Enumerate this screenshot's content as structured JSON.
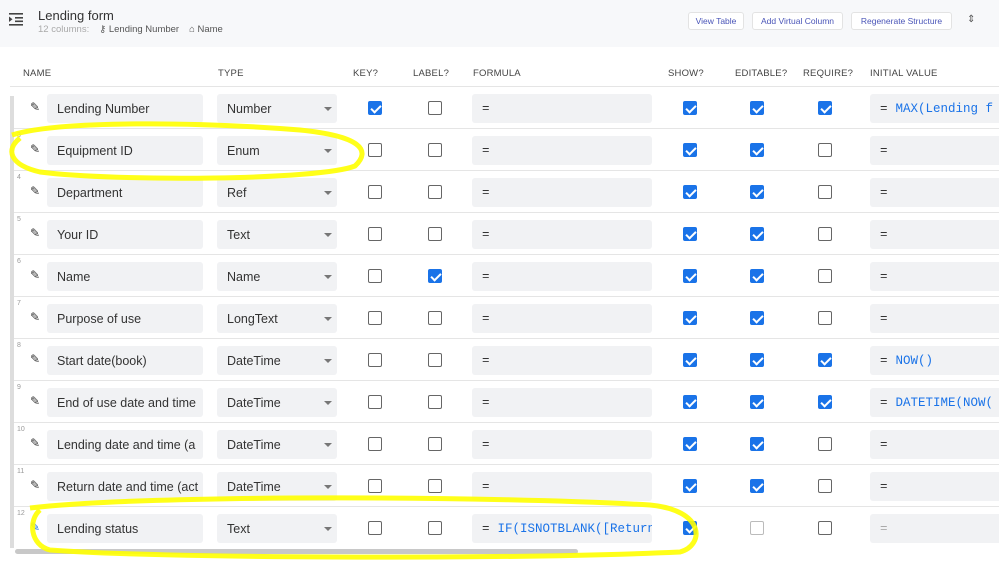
{
  "header": {
    "title": "Lending form",
    "columns_count": "12 columns:",
    "key_column": "Lending Number",
    "label_column": "Name",
    "buttons": {
      "view_table": "View Table",
      "add_virtual_column": "Add Virtual Column",
      "regenerate_structure": "Regenerate Structure"
    }
  },
  "columns": {
    "name": "NAME",
    "type": "TYPE",
    "key": "KEY?",
    "label": "LABEL?",
    "formula": "FORMULA",
    "show": "SHOW?",
    "editable": "EDITABLE?",
    "require": "REQUIRE?",
    "initial_value": "INITIAL VALUE"
  },
  "rows": [
    {
      "num": "",
      "name": "Lending Number",
      "type": "Number",
      "key": true,
      "label": false,
      "formula": "",
      "show": true,
      "editable": true,
      "require": true,
      "initial": "MAX(Lending f"
    },
    {
      "num": "3",
      "name": "Equipment ID",
      "type": "Enum",
      "key": false,
      "label": false,
      "formula": "",
      "show": true,
      "editable": true,
      "require": false,
      "initial": ""
    },
    {
      "num": "4",
      "name": "Department",
      "type": "Ref",
      "key": false,
      "label": false,
      "formula": "",
      "show": true,
      "editable": true,
      "require": false,
      "initial": ""
    },
    {
      "num": "5",
      "name": "Your ID",
      "type": "Text",
      "key": false,
      "label": false,
      "formula": "",
      "show": true,
      "editable": true,
      "require": false,
      "initial": ""
    },
    {
      "num": "6",
      "name": "Name",
      "type": "Name",
      "key": false,
      "label": true,
      "formula": "",
      "show": true,
      "editable": true,
      "require": false,
      "initial": ""
    },
    {
      "num": "7",
      "name": "Purpose of use",
      "type": "LongText",
      "key": false,
      "label": false,
      "formula": "",
      "show": true,
      "editable": true,
      "require": false,
      "initial": ""
    },
    {
      "num": "8",
      "name": "Start date(book)",
      "type": "DateTime",
      "key": false,
      "label": false,
      "formula": "",
      "show": true,
      "editable": true,
      "require": true,
      "initial": "NOW()"
    },
    {
      "num": "9",
      "name": "End of use date and time",
      "type": "DateTime",
      "key": false,
      "label": false,
      "formula": "",
      "show": true,
      "editable": true,
      "require": true,
      "initial": "DATETIME(NOW("
    },
    {
      "num": "10",
      "name": "Lending date and time (a",
      "type": "DateTime",
      "key": false,
      "label": false,
      "formula": "",
      "show": true,
      "editable": true,
      "require": false,
      "initial": ""
    },
    {
      "num": "11",
      "name": "Return date and time (act",
      "type": "DateTime",
      "key": false,
      "label": false,
      "formula": "",
      "show": true,
      "editable": true,
      "require": false,
      "initial": ""
    },
    {
      "num": "12",
      "name": "Lending status",
      "type": "Text",
      "key": false,
      "label": false,
      "formula": "IF(ISNOTBLANK([Return",
      "show": true,
      "editable": false,
      "editable_disabled": true,
      "require": false,
      "initial": "",
      "initial_disabled": true
    }
  ],
  "equals": "=",
  "colors": {
    "accent": "#1a73e8",
    "highlight": "#ffff00",
    "button_text": "#4a55b8"
  }
}
